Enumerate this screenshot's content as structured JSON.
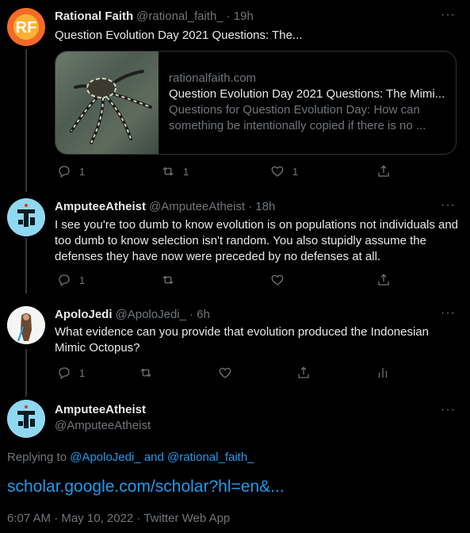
{
  "tweets": [
    {
      "name": "Rational Faith",
      "handle": "@rational_faith_",
      "time": "· 19h",
      "text": "Question Evolution Day 2021 Questions: The...",
      "card": {
        "domain": "rationalfaith.com",
        "title": "Question Evolution Day 2021 Questions: The Mimi...",
        "desc": "Questions for Question Evolution Day: How can something be intentionally copied if there is no ..."
      },
      "replies": "1",
      "retweets": "1",
      "likes": "1"
    },
    {
      "name": "AmputeeAtheist",
      "handle": "@AmputeeAtheist",
      "time": "· 18h",
      "text": "I see you're too dumb to know evolution is on populations not individuals and too dumb to know selection isn't random. You also stupidly assume the defenses they have now were preceded by no defenses at all.",
      "replies": "1"
    },
    {
      "name": "ApoloJedi",
      "handle": "@ApoloJedi_",
      "time": "· 6h",
      "text": "What evidence can you provide that evolution produced the Indonesian Mimic Octopus?",
      "replies": "1"
    }
  ],
  "focus": {
    "name": "AmputeeAtheist",
    "handle": "@AmputeeAtheist",
    "replying_prefix": "Replying to",
    "replying_user1": "@ApoloJedi_",
    "replying_and": "and",
    "replying_user2": "@rational_faith_",
    "link_text": "scholar.google.com/scholar?hl=en&...",
    "timestamp": "6:07 AM · May 10, 2022 · Twitter Web App"
  },
  "more_label": "···",
  "icons": [
    "reply-icon",
    "retweet-icon",
    "like-icon",
    "share-icon",
    "analytics-icon",
    "more-icon"
  ],
  "colors": {
    "background": "#000000",
    "text": "#e7e9ea",
    "muted": "#71767b",
    "link": "#1d9bf0"
  }
}
